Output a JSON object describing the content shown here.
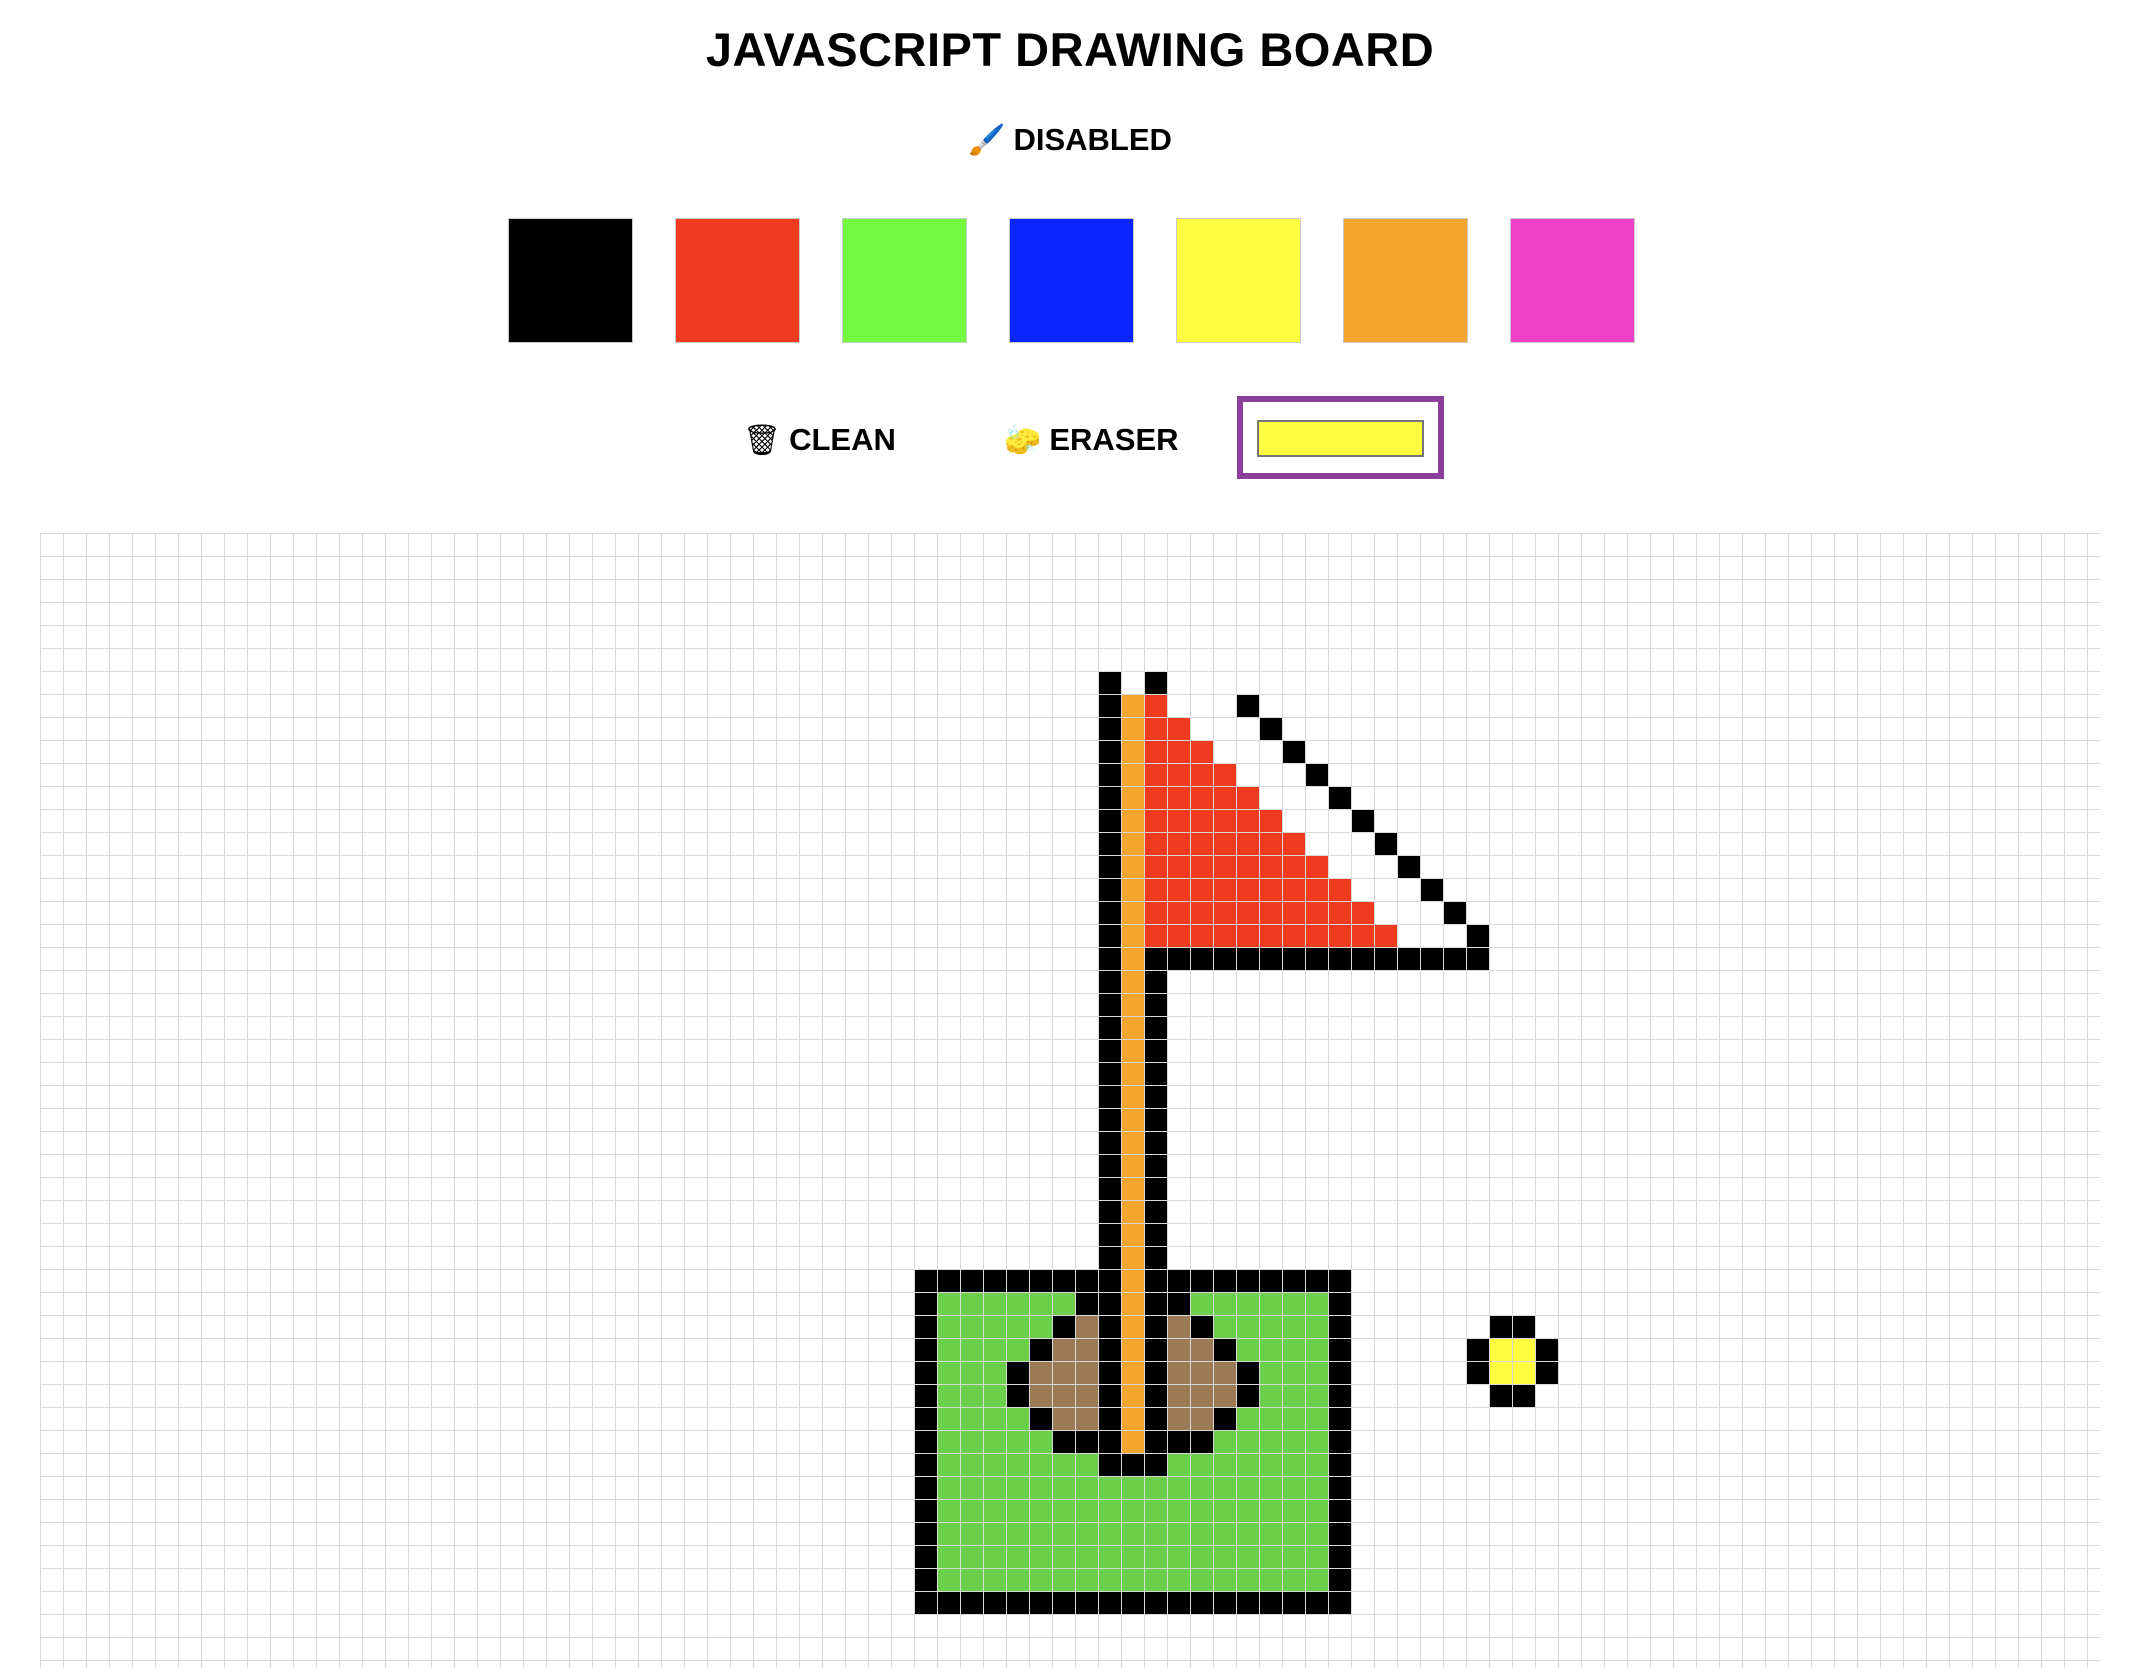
{
  "header": {
    "title": "JAVASCRIPT DRAWING BOARD"
  },
  "toolbar": {
    "toggle_icon": "🖌️",
    "toggle_icon_name": "paintbrush-icon",
    "toggle_label": "DISABLED"
  },
  "palette": {
    "colors": [
      {
        "name": "black",
        "hex": "#000000"
      },
      {
        "name": "red",
        "hex": "#ee3a1f"
      },
      {
        "name": "green",
        "hex": "#71f940"
      },
      {
        "name": "blue",
        "hex": "#0a24fb"
      },
      {
        "name": "yellow",
        "hex": "#fffd42"
      },
      {
        "name": "orange",
        "hex": "#f4a62f"
      },
      {
        "name": "pink",
        "hex": "#ec40c6"
      }
    ]
  },
  "actions": {
    "clean_icon": "🗑",
    "clean_icon_name": "trash-icon",
    "clean_label": "CLEAN",
    "eraser_icon": "🧽",
    "eraser_icon_name": "sponge-icon",
    "eraser_label": "ERASER",
    "picker_value": "#fffd42",
    "picker_border_color": "#8b3e9a"
  },
  "board": {
    "grid_line_color": "#d8d8d8",
    "cell_colors": {
      "K": "#000000",
      "O": "#f4a62f",
      "R": "#ee3a1f",
      "G": "#6ad04a",
      "B": "#9b7a55",
      "Y": "#fffd42"
    },
    "drawing": [
      "..............................................K.K.........................................",
      "..............................................KOR...K......................................",
      "..............................................KORR...K.....................................",
      "..............................................KORRR...K....................................",
      "..............................................KORRRR...K...................................",
      "..............................................KORRRRR...K..................................",
      "..............................................KORRRRRR...K.................................",
      "..............................................KORRRRRRR...K................................",
      "..............................................KORRRRRRRR...K...............................",
      "..............................................KORRRRRRRRR...K..............................",
      "..............................................KORRRRRRRRRR...K.............................",
      "..............................................KORRRRRRRRRRR...K............................",
      "..............................................KOKKKKKKKKKKKKKKK...........................",
      "..............................................KOK..........................................",
      "..............................................KOK..........................................",
      "..............................................KOK..........................................",
      "..............................................KOK..........................................",
      "..............................................KOK..........................................",
      "..............................................KOK..........................................",
      "..............................................KOK..........................................",
      "..............................................KOK..........................................",
      "..............................................KOK..........................................",
      "..............................................KOK..........................................",
      "..............................................KOK..........................................",
      "..............................................KOK..........................................",
      "..............................................KOK..........................................",
      "......................................KKKKKKKKKOKKKKKKKKK..................................",
      "......................................KGGGGGGKKOKKGGGGGGK..................................",
      "......................................KGGGGGKBKOKBKGGGGGK......KK..........................",
      "......................................KGGGGKBBKOKBBKGGGGK.....KYYK.........................",
      "......................................KGGGKBBBKOKBBBKGGGK.....KYYK.........................",
      "......................................KGGGKBBBKOKBBBKGGGK......KK..........................",
      "......................................KGGGGKBBKOKBBKGGGGK..................................",
      "......................................KGGGGGKKKOKKKGGGGGK..................................",
      "......................................KGGGGGGGKKKGGGGGGGK..................................",
      "......................................KGGGGGGGGGGGGGGGGGK..................................",
      "......................................KGGGGGGGGGGGGGGGGGK..................................",
      "......................................KGGGGGGGGGGGGGGGGGK..................................",
      "......................................KGGGGGGGGGGGGGGGGGK..................................",
      "......................................KGGGGGGGGGGGGGGGGGK..................................",
      "......................................KKKKKKKKKKKKKKKKKKK.................................."
    ]
  }
}
